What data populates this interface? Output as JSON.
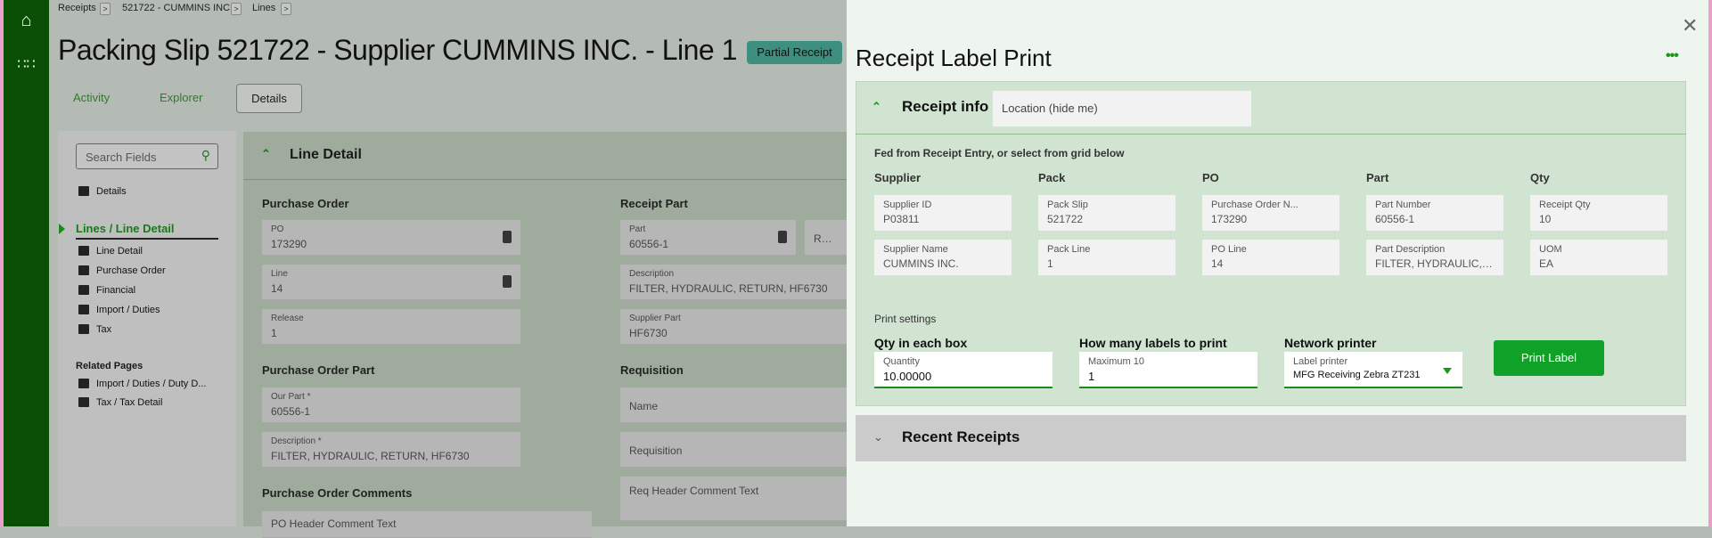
{
  "breadcrumb": [
    "Receipts",
    "521722 - CUMMINS INC.",
    "Lines"
  ],
  "page_title": "Packing Slip 521722 - Supplier CUMMINS INC. - Line 1",
  "status_badge": "Partial Receipt",
  "tabs": [
    "Activity",
    "Explorer",
    "Details"
  ],
  "sidebar": {
    "search_placeholder": "Search Fields",
    "details": "Details",
    "section": "Lines / Line Detail",
    "items": [
      "Line Detail",
      "Purchase Order",
      "Financial",
      "Import / Duties",
      "Tax"
    ],
    "related_title": "Related Pages",
    "related": [
      "Import / Duties / Duty D...",
      "Tax / Tax Detail"
    ]
  },
  "form": {
    "title": "Line Detail",
    "po_group": "Purchase Order",
    "po": {
      "label": "PO",
      "value": "173290"
    },
    "line": {
      "label": "Line",
      "value": "14"
    },
    "release": {
      "label": "Release",
      "value": "1"
    },
    "pop_group": "Purchase Order Part",
    "our_part": {
      "label": "Our Part *",
      "value": "60556-1"
    },
    "description": {
      "label": "Description *",
      "value": "FILTER, HYDRAULIC, RETURN, HF6730"
    },
    "comments_group": "Purchase Order Comments",
    "po_header_comment": "PO Header Comment Text",
    "rp_group": "Receipt Part",
    "part": {
      "label": "Part",
      "value": "60556-1"
    },
    "revision_label": "Revi...",
    "rp_description": {
      "label": "Description",
      "value": "FILTER, HYDRAULIC, RETURN, HF6730"
    },
    "supplier_part": {
      "label": "Supplier Part",
      "value": "HF6730"
    },
    "req_group": "Requisition",
    "req_name": "Name",
    "req_requisition": "Requisition",
    "req_header_comment": "Req Header Comment Text"
  },
  "drawer": {
    "title": "Receipt Label Print",
    "receipt_info": "Receipt info",
    "location_placeholder": "Location (hide me)",
    "fed_note": "Fed from Receipt Entry, or select from grid below",
    "columns": [
      {
        "head": "Supplier",
        "f1": {
          "k": "Supplier ID",
          "v": "P03811"
        },
        "f2": {
          "k": "Supplier Name",
          "v": "CUMMINS INC."
        }
      },
      {
        "head": "Pack",
        "f1": {
          "k": "Pack Slip",
          "v": "521722"
        },
        "f2": {
          "k": "Pack Line",
          "v": "1"
        }
      },
      {
        "head": "PO",
        "f1": {
          "k": "Purchase Order N...",
          "v": "173290"
        },
        "f2": {
          "k": "PO Line",
          "v": "14"
        }
      },
      {
        "head": "Part",
        "f1": {
          "k": "Part Number",
          "v": "60556-1"
        },
        "f2": {
          "k": "Part Description",
          "v": "FILTER, HYDRAULIC, R..."
        }
      },
      {
        "head": "Qty",
        "f1": {
          "k": "Receipt Qty",
          "v": "10"
        },
        "f2": {
          "k": "UOM",
          "v": "EA"
        }
      }
    ],
    "print_settings": "Print settings",
    "qty_label": "Qty in each box",
    "qty_field": "Quantity",
    "qty_value": "10.00000",
    "labels_label": "How many labels to print",
    "labels_field": "Maximum 10",
    "labels_value": "1",
    "printer_label": "Network printer",
    "printer_field": "Label printer",
    "printer_value": "MFG Receiving Zebra ZT231",
    "print_button": "Print Label",
    "recent": "Recent Receipts"
  }
}
